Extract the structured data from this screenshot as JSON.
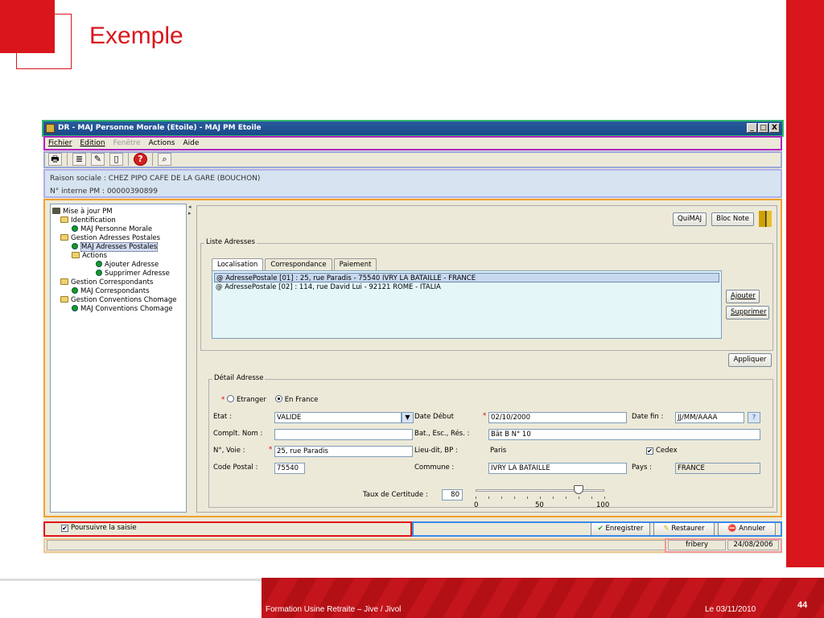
{
  "slide": {
    "title": "Exemple",
    "footer_left": "Formation Usine Retraite – Jive / Jivol",
    "footer_date": "Le 03/11/2010",
    "page_number": "44",
    "colors": {
      "brand_red": "#d9161c"
    }
  },
  "window": {
    "title": "DR - MAJ Personne Morale (Etoile) - MAJ PM Etoile",
    "buttons": {
      "minimize": "_",
      "maximize": "□",
      "close": "X"
    }
  },
  "menu": {
    "items": [
      "Fichier",
      "Edition",
      "Fenêtre",
      "Actions",
      "Aide"
    ]
  },
  "toolbar": {
    "icons": [
      "printer-icon",
      "list-icon",
      "edit-icon",
      "clipboard-icon",
      "help-icon",
      "search-icon"
    ]
  },
  "info": {
    "raison_sociale": "Raison sociale : CHEZ PIPO CAFE DE LA GARE (BOUCHON)",
    "numero_interne": "N° interne PM : 00000390899"
  },
  "tree": {
    "root": "Mise à jour PM",
    "nodes": [
      {
        "label": "Identification"
      },
      {
        "label": "MAJ Personne Morale"
      },
      {
        "label": "Gestion Adresses Postales"
      },
      {
        "label": "MAJ Adresses Postales"
      },
      {
        "label": "Actions"
      },
      {
        "label": "Ajouter Adresse"
      },
      {
        "label": "Supprimer Adresse"
      },
      {
        "label": "Gestion Correspondants"
      },
      {
        "label": "MAJ Correspondants"
      },
      {
        "label": "Gestion Conventions Chomage"
      },
      {
        "label": "MAJ Conventions Chomage"
      }
    ]
  },
  "header_buttons": {
    "quimaj": "QuiMAJ",
    "bloc_note": "Bloc Note"
  },
  "liste": {
    "title": "Liste Adresses",
    "tabs": [
      "Localisation",
      "Correspondance",
      "Paiement"
    ],
    "rows": [
      "@ AdressePostale [01] : 25, rue Paradis - 75540 IVRY LA BATAILLE - FRANCE",
      "@ AdressePostale [02] : 114, rue David Lui - 92121 ROME - ITALIA"
    ],
    "ajouter": "Ajouter",
    "supprimer": "Supprimer"
  },
  "appliquer": "Appliquer",
  "detail": {
    "title": "Détail Adresse",
    "radio_etranger": "Etranger",
    "radio_en_france": "En France",
    "etat_label": "Etat :",
    "etat_value": "VALIDE",
    "date_debut_label": "Date Début",
    "date_debut_value": "02/10/2000",
    "date_fin_label": "Date fin :",
    "date_fin_value": "JJ/MM/AAAA",
    "date_fin_btn": "?",
    "compl_nom_label": "Complt. Nom :",
    "compl_nom_value": "",
    "bat_label": "Bat., Esc., Rés. :",
    "bat_value": "Bât B N° 10",
    "voie_label": "N°, Voie :",
    "voie_value": "25, rue Paradis",
    "lieu_dit_label": "Lieu-dit, BP :",
    "lieu_dit_value": "Paris",
    "cedex_label": "Cedex",
    "code_postal_label": "Code Postal :",
    "code_postal_value": "75540",
    "commune_label": "Commune :",
    "commune_value": "IVRY LA BATAILLE",
    "pays_label": "Pays :",
    "pays_value": "FRANCE",
    "certitude_label": "Taux de Certitude :",
    "certitude_value": "80",
    "slider": {
      "min": "0",
      "mid": "50",
      "max": "100",
      "value": 80
    }
  },
  "bottom": {
    "poursuivre": "Poursuivre la saisie",
    "enregistrer": "Enregistrer",
    "restaurer": "Restaurer",
    "annuler": "Annuler"
  },
  "status": {
    "user": "fribery",
    "date": "24/08/2006"
  }
}
